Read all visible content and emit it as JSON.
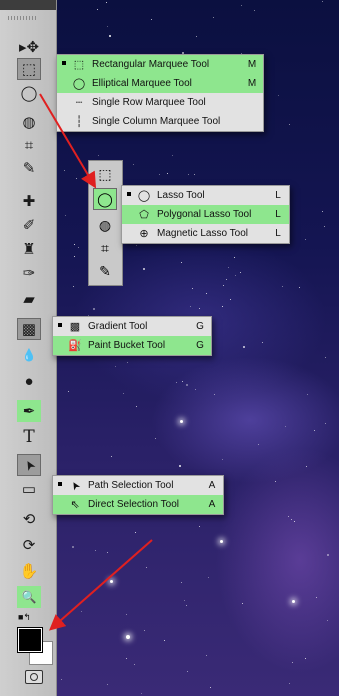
{
  "toolbar": {
    "tools": [
      {
        "name": "move-icon",
        "glyph": "▸✥"
      },
      {
        "name": "rectangular-marquee-icon",
        "glyph": "⬚"
      },
      {
        "name": "lasso-icon",
        "glyph": "◯"
      },
      {
        "name": "quick-selection-icon",
        "glyph": "◍"
      },
      {
        "name": "crop-icon",
        "glyph": "⌗"
      },
      {
        "name": "eyedropper-icon",
        "glyph": "✎"
      },
      {
        "name": "spot-healing-icon",
        "glyph": "✚"
      },
      {
        "name": "brush-icon",
        "glyph": "✐"
      },
      {
        "name": "clone-stamp-icon",
        "glyph": "♜"
      },
      {
        "name": "history-brush-icon",
        "glyph": "✑"
      },
      {
        "name": "eraser-icon",
        "glyph": "▰"
      },
      {
        "name": "gradient-icon",
        "glyph": "▩"
      },
      {
        "name": "blur-icon",
        "glyph": "💧"
      },
      {
        "name": "dodge-icon",
        "glyph": "●"
      },
      {
        "name": "pen-icon",
        "glyph": "✒"
      },
      {
        "name": "type-icon",
        "glyph": "T"
      },
      {
        "name": "path-selection-icon",
        "glyph": "➤"
      },
      {
        "name": "shape-icon",
        "glyph": "▭"
      },
      {
        "name": "3d-rotate-icon",
        "glyph": "⟲"
      },
      {
        "name": "3d-orbit-icon",
        "glyph": "⟳"
      },
      {
        "name": "hand-icon",
        "glyph": "✋"
      },
      {
        "name": "zoom-icon",
        "glyph": "🔍"
      }
    ]
  },
  "marquee_flyout": {
    "items": [
      {
        "label": "Rectangular Marquee Tool",
        "key": "M",
        "icon": "rect-marquee-icon",
        "glyph": "⬚"
      },
      {
        "label": "Elliptical Marquee Tool",
        "key": "M",
        "icon": "ellipse-marquee-icon",
        "glyph": "◯"
      },
      {
        "label": "Single Row Marquee Tool",
        "key": "",
        "icon": "single-row-icon",
        "glyph": "┄"
      },
      {
        "label": "Single Column Marquee Tool",
        "key": "",
        "icon": "single-column-icon",
        "glyph": "┆"
      }
    ]
  },
  "lasso_flyout": {
    "items": [
      {
        "label": "Lasso Tool",
        "key": "L",
        "icon": "lasso-icon",
        "glyph": "◯"
      },
      {
        "label": "Polygonal Lasso Tool",
        "key": "L",
        "icon": "polygonal-lasso-icon",
        "glyph": "⬠"
      },
      {
        "label": "Magnetic Lasso Tool",
        "key": "L",
        "icon": "magnetic-lasso-icon",
        "glyph": "⊕"
      }
    ]
  },
  "gradient_flyout": {
    "items": [
      {
        "label": "Gradient Tool",
        "key": "G",
        "icon": "gradient-icon",
        "glyph": "▩"
      },
      {
        "label": "Paint Bucket Tool",
        "key": "G",
        "icon": "paint-bucket-icon",
        "glyph": "⛽"
      }
    ]
  },
  "path_flyout": {
    "items": [
      {
        "label": "Path Selection Tool",
        "key": "A",
        "icon": "path-selection-icon",
        "glyph": "➤"
      },
      {
        "label": "Direct Selection Tool",
        "key": "A",
        "icon": "direct-selection-icon",
        "glyph": "⇖"
      }
    ]
  },
  "colors": {
    "highlight": "#8ee68e",
    "arrow": "#e02020",
    "foreground": "#000000",
    "background": "#ffffff"
  }
}
